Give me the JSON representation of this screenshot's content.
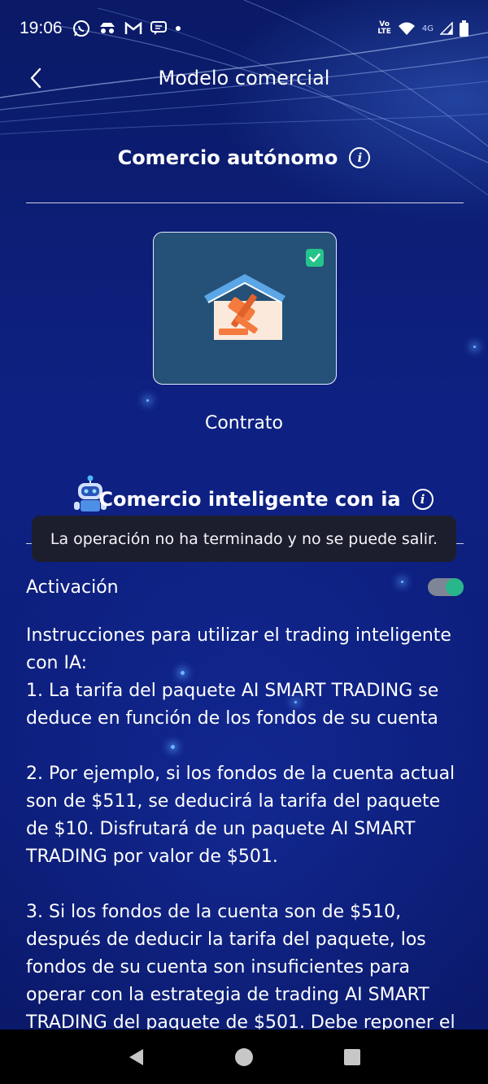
{
  "status_bar": {
    "time": "19:06",
    "left_icons": [
      "whatsapp-icon",
      "incognito-icon",
      "gmail-icon",
      "message-icon",
      "dot-icon"
    ],
    "right_icons": [
      "volte-icon",
      "wifi-icon",
      "signal-4g-icon",
      "battery-icon"
    ],
    "lte_top": "Vo",
    "lte_bottom": "LTE",
    "network": "4G"
  },
  "header": {
    "title": "Modelo comercial",
    "back_icon": "chevron-left-icon"
  },
  "autonomous_section": {
    "title": "Comercio autónomo",
    "info_icon_text": "i"
  },
  "card": {
    "label": "Contrato",
    "selected": true,
    "icon": "gavel-house-icon"
  },
  "ai_section": {
    "title": "Comercio inteligente con ia",
    "info_icon_text": "i"
  },
  "toast": {
    "message": "La operación no ha terminado y no se puede salir."
  },
  "activation": {
    "label": "Activación",
    "enabled": true
  },
  "instructions": {
    "intro": "Instrucciones para utilizar el trading inteligente con IA:",
    "p1": "1. La tarifa del paquete AI SMART TRADING se deduce en función de los fondos de su cuenta",
    "p2": "2. Por ejemplo, si los fondos de la cuenta actual son de $511, se deducirá la tarifa del paquete de $10. Disfrutará de un paquete AI SMART TRADING por valor de $501.",
    "p3": "3. Si los fondos de la cuenta son de $510, después de deducir la tarifa del paquete, los fondos de su cuenta son insuficientes para operar con la estrategia de trading AI SMART TRADING del paquete de $501. Debe reponer el"
  },
  "colors": {
    "background": "#0e2183",
    "card": "#255077",
    "accent_green": "#27b78a",
    "toast": "#1c1e2d"
  },
  "nav_bar": {
    "buttons": [
      "back-triangle-icon",
      "home-circle-icon",
      "recents-square-icon"
    ]
  }
}
